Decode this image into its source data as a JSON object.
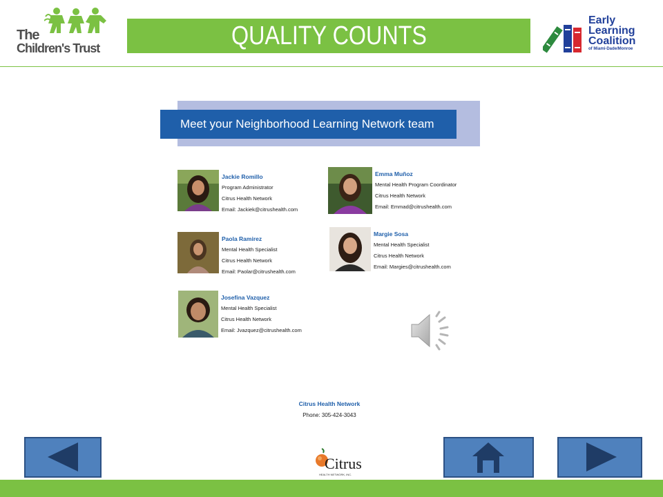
{
  "header": {
    "left_logo": {
      "line1": "The",
      "line2": "Children's Trust"
    },
    "title": "QUALITY COUNTS",
    "right_logo": {
      "word1": "Early",
      "word2": "Learning",
      "word3": "Coalition",
      "tagline": "of Miami-Dade/Monroe"
    }
  },
  "content": {
    "banner_title": "Meet your Neighborhood Learning Network team",
    "team": [
      {
        "name": "Jackie Romillo",
        "role": "Program Administrator",
        "org": "Citrus Health Network",
        "email": "Email: Jackiek@citrushealth.com"
      },
      {
        "name": "Emma Muñoz",
        "role": "Mental Health Program Coordinator",
        "org": "Citrus Health Network",
        "email": "Email: Emmad@citrushealth.com"
      },
      {
        "name": "Paola Ramirez",
        "role": "Mental Health Specialist",
        "org": "Citrus Health Network",
        "email": "Email: Paolar@citrushealth.com"
      },
      {
        "name": "Margie Sosa",
        "role": "Mental Health Specialist",
        "org": "Citrus Health Network",
        "email": "Email: Margies@citrushealth.com"
      },
      {
        "name": "Josefina Vazquez",
        "role": "Mental Health Specialist",
        "org": "Citrus Health Network",
        "email": "Email: Jvazquez@citrushealth.com"
      }
    ],
    "footer_org": "Citrus Health Network",
    "footer_phone": "Phone: 305-424-3043"
  },
  "bottom_logo": {
    "word": "Citrus",
    "tagline": "HEALTH NETWORK, INC."
  },
  "icons": {
    "audio": "speaker-icon",
    "prev": "left-arrow-icon",
    "home": "house-icon",
    "next": "right-arrow-icon"
  },
  "colors": {
    "brand_green": "#7bc143",
    "banner_blue": "#1f5faa",
    "banner_light": "#b4bde0",
    "button_blue": "#4f81bd",
    "button_dark": "#1f3c66"
  }
}
